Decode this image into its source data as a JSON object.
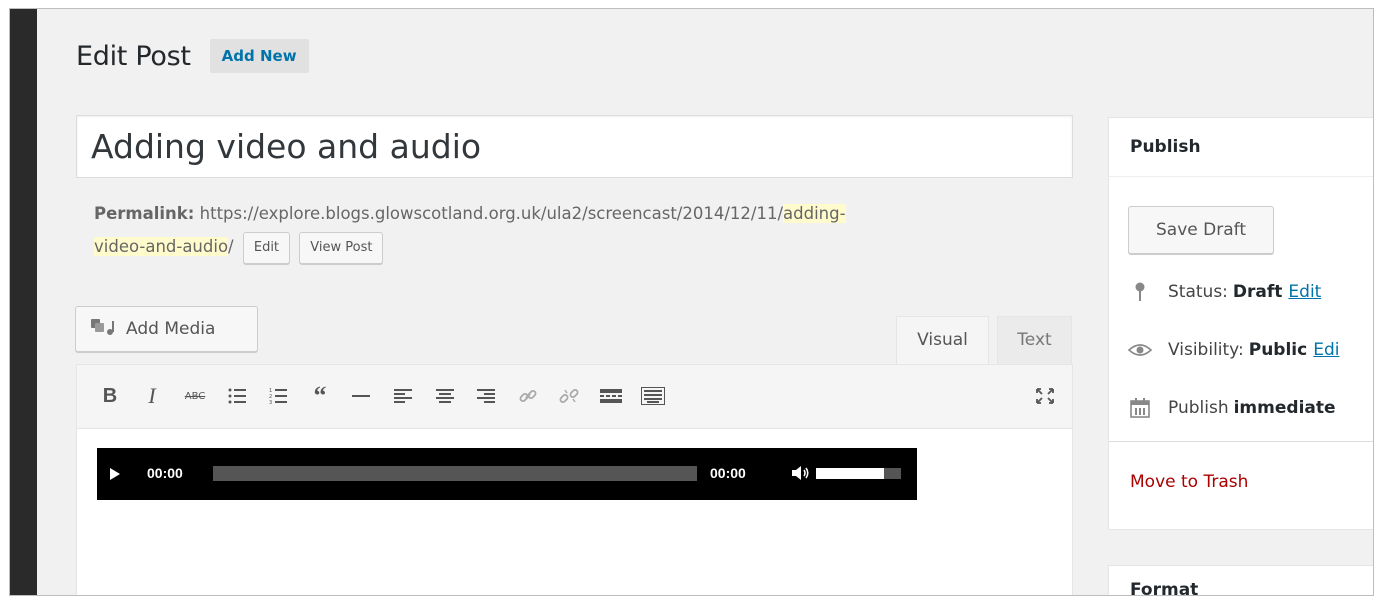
{
  "page": {
    "title": "Edit Post",
    "add_new_label": "Add New"
  },
  "post": {
    "title_value": "Adding video and audio",
    "permalink_label": "Permalink:",
    "permalink_base": "https://explore.blogs.glowscotland.org.uk/ula2/screencast/2014/12/11/",
    "permalink_slug_part1": "adding-",
    "permalink_slug_part2": "video-and-audio",
    "permalink_trailing": "/",
    "edit_slug_label": "Edit",
    "view_post_label": "View Post"
  },
  "editor": {
    "add_media_label": "Add Media",
    "tabs": {
      "visual": "Visual",
      "text": "Text"
    },
    "toolbar_icons": [
      "bold-icon",
      "italic-icon",
      "strikethrough-icon",
      "bulleted-list-icon",
      "numbered-list-icon",
      "blockquote-icon",
      "horizontal-line-icon",
      "align-left-icon",
      "align-center-icon",
      "align-right-icon",
      "insert-link-icon",
      "remove-link-icon",
      "read-more-icon",
      "toolbar-toggle-icon",
      "fullscreen-icon"
    ],
    "audio_player": {
      "current_time": "00:00",
      "duration": "00:00",
      "progress": 0,
      "volume": 0.8
    }
  },
  "publish": {
    "title": "Publish",
    "save_draft_label": "Save Draft",
    "status_label": "Status:",
    "status_value": "Draft",
    "status_edit": "Edit",
    "visibility_label": "Visibility:",
    "visibility_value": "Public",
    "visibility_edit": "Edi",
    "publish_label": "Publish",
    "publish_value": "immediate",
    "move_to_trash": "Move to Trash"
  },
  "format": {
    "title": "Format"
  },
  "colors": {
    "link": "#0073aa",
    "trash": "#aa0000",
    "slug_highlight": "#fffbcc",
    "admin_bar": "#2a2a2a"
  }
}
